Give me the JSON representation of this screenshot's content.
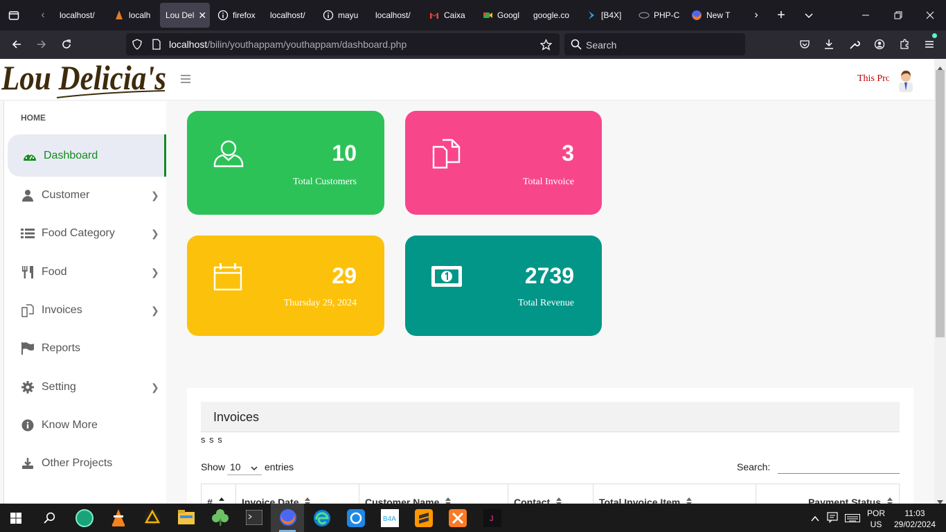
{
  "browser": {
    "tabs": [
      {
        "label": "localhost/",
        "icon": "globe-icon"
      },
      {
        "label": "localh",
        "icon": "sailboat-icon"
      },
      {
        "label": "Lou Del",
        "icon": "none",
        "active": true
      },
      {
        "label": "firefox",
        "icon": "info-icon"
      },
      {
        "label": "localhost/",
        "icon": "none"
      },
      {
        "label": "mayu",
        "icon": "info-icon"
      },
      {
        "label": "localhost/",
        "icon": "none"
      },
      {
        "label": "Caixa",
        "icon": "gmail-icon"
      },
      {
        "label": "Googl",
        "icon": "google-meet-icon"
      },
      {
        "label": "google.co",
        "icon": "none"
      },
      {
        "label": "[B4X]",
        "icon": "b4x-icon"
      },
      {
        "label": "PHP-C",
        "icon": "php-icon"
      },
      {
        "label": "New T",
        "icon": "firefox-icon"
      }
    ],
    "url_host": "localhost",
    "url_path": "/bilin/youthappam/youthappam/dashboard.php",
    "search_placeholder": "Search"
  },
  "app": {
    "logo_text": "Lou Delicia's",
    "profile_text": "This Pro",
    "section_label": "HOME",
    "nav": [
      {
        "label": "Dashboard",
        "icon": "dashboard-icon",
        "active": true,
        "chevron": false
      },
      {
        "label": "Customer",
        "icon": "user-icon",
        "chevron": true
      },
      {
        "label": "Food Category",
        "icon": "list-icon",
        "chevron": true
      },
      {
        "label": "Food",
        "icon": "utensils-icon",
        "chevron": true
      },
      {
        "label": "Invoices",
        "icon": "invoice-icon",
        "chevron": true
      },
      {
        "label": "Reports",
        "icon": "flag-icon",
        "chevron": false
      },
      {
        "label": "Setting",
        "icon": "gear-icon",
        "chevron": true
      },
      {
        "label": "Know More",
        "icon": "info-icon",
        "chevron": false
      },
      {
        "label": "Other Projects",
        "icon": "download-icon",
        "chevron": false
      }
    ]
  },
  "cards": [
    {
      "value": "10",
      "label": "Total Customers",
      "color": "#2dc258",
      "icon": "user-icon"
    },
    {
      "value": "3",
      "label": "Total Invoice",
      "color": "#f8468b",
      "icon": "documents-icon"
    },
    {
      "value": "29",
      "label": "Thursday 29, 2024",
      "color": "#fcc10a",
      "icon": "calendar-icon"
    },
    {
      "value": "2739",
      "label": "Total Revenue",
      "color": "#019688",
      "icon": "money-icon"
    }
  ],
  "invoices": {
    "title": "Invoices",
    "note": "s s s",
    "show_label": "Show",
    "entries_value": "10",
    "entries_label": "entries",
    "search_label": "Search:",
    "columns": [
      "#",
      "Invoice Date",
      "Customer Name",
      "Contact",
      "Total Invoice Item",
      "Payment Status"
    ]
  },
  "taskbar": {
    "lang": "POR",
    "region": "US",
    "time": "11:03",
    "date": "29/02/2024"
  }
}
